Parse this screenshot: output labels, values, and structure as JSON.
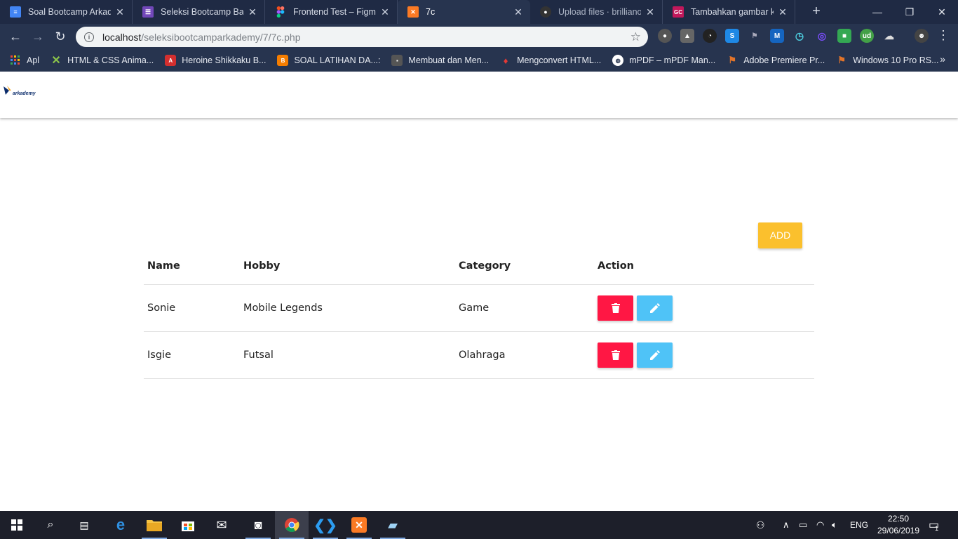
{
  "browser": {
    "tabs": [
      {
        "label": "Soal Bootcamp Arkademy",
        "favicon": "docs-icon",
        "color": "#4285f4"
      },
      {
        "label": "Seleksi Bootcamp Batch",
        "favicon": "forms-icon",
        "color": "#7248b9"
      },
      {
        "label": "Frontend Test – Figma",
        "favicon": "figma-icon",
        "color": "#f24e1e"
      },
      {
        "label": "7c",
        "favicon": "xampp-icon",
        "color": "#fb7a24"
      },
      {
        "label": "Upload files · brillianodh",
        "favicon": "github-icon",
        "color": "#333333"
      },
      {
        "label": "Tambahkan gambar ke",
        "favicon": "gc-icon",
        "color": "#c2185b"
      }
    ],
    "active_tab": 3,
    "url_host": "localhost",
    "url_path": "/seleksibootcamparkademy/7/7c.php",
    "bookmarks": [
      {
        "label": "Apl",
        "icon": "apps-grid-icon",
        "color": "#e8453c"
      },
      {
        "label": "HTML & CSS Anima...",
        "icon": "x-icon",
        "color": "#8bc34a"
      },
      {
        "label": "Heroine Shikkaku B...",
        "icon": "anime-icon",
        "color": "#d32f2f"
      },
      {
        "label": "SOAL LATIHAN DA...:",
        "icon": "blogger-icon",
        "color": "#f57d00"
      },
      {
        "label": "Membuat dan Men...",
        "icon": "isal-icon",
        "color": "#555555"
      },
      {
        "label": "Mengconvert HTML...",
        "icon": "drop-icon",
        "color": "#3a3a55"
      },
      {
        "label": "mPDF – mPDF Man...",
        "icon": "globe-icon",
        "color": "#ffffff"
      },
      {
        "label": "Adobe Premiere Pr...",
        "icon": "windows-flag-icon",
        "color": "#e2742a"
      },
      {
        "label": "Windows 10 Pro RS...",
        "icon": "windows-flag-icon",
        "color": "#e2742a"
      }
    ]
  },
  "page": {
    "logo_text": "arkademy",
    "add_label": "ADD",
    "columns": [
      "Name",
      "Hobby",
      "Category",
      "Action"
    ],
    "rows": [
      {
        "name": "Sonie",
        "hobby": "Mobile Legends",
        "category": "Game"
      },
      {
        "name": "Isgie",
        "hobby": "Futsal",
        "category": "Olahraga"
      }
    ],
    "colors": {
      "add": "#fbc02d",
      "delete": "#ff1744",
      "edit": "#4fc3f7"
    }
  },
  "taskbar": {
    "language": "ENG",
    "time": "22:50",
    "date": "29/06/2019",
    "notification_count": "1"
  }
}
